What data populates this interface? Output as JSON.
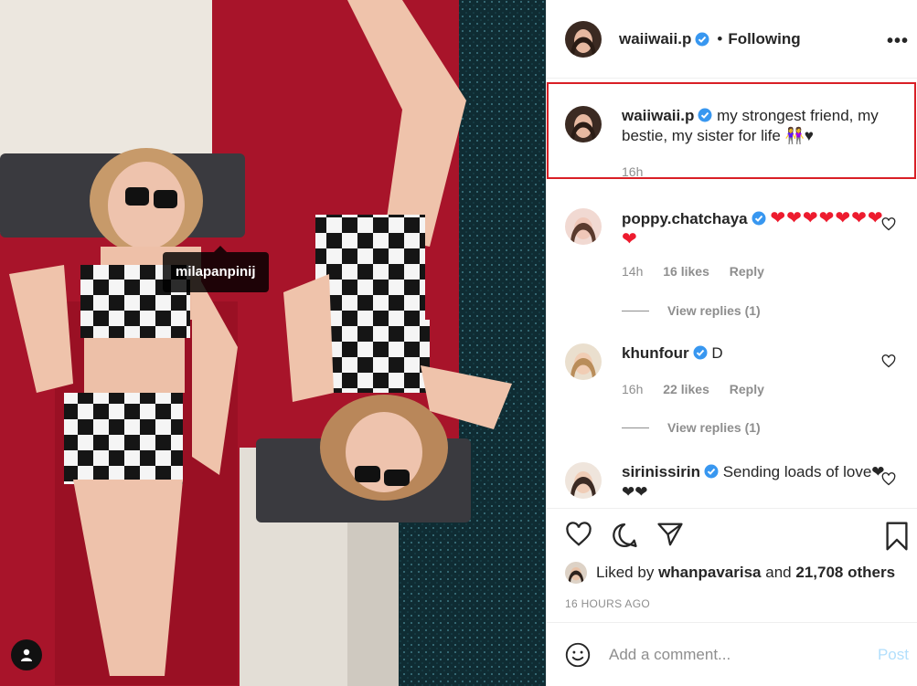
{
  "post": {
    "author": "waiiwaii.p",
    "follow_status": "Following",
    "separator": "•",
    "more_label": "•••",
    "photo_tag": "milapanpinij"
  },
  "caption": {
    "username": "waiiwaii.p",
    "text": "my strongest friend, my bestie, my sister for life 👭♥",
    "time": "16h"
  },
  "comments": [
    {
      "username": "poppy.chatchaya",
      "text": "❤❤❤❤❤❤❤❤",
      "time": "14h",
      "likes": "16 likes",
      "reply": "Reply",
      "view_replies": "View replies (1)"
    },
    {
      "username": "khunfour",
      "text": "D",
      "time": "16h",
      "likes": "22 likes",
      "reply": "Reply",
      "view_replies": "View replies (1)"
    },
    {
      "username": "sirinissirin",
      "text": "Sending loads of love❤❤❤"
    }
  ],
  "likes": {
    "prefix": "Liked by",
    "liker": "whanpavarisa",
    "and": "and",
    "others": "21,708 others"
  },
  "timestamp": "16 HOURS AGO",
  "comment_box": {
    "placeholder": "Add a comment...",
    "post_label": "Post"
  },
  "colors": {
    "verified": "#3897f0",
    "highlight_border": "#d91f26",
    "heart": "#ed1b2e",
    "post_disabled": "#b2dffc"
  }
}
